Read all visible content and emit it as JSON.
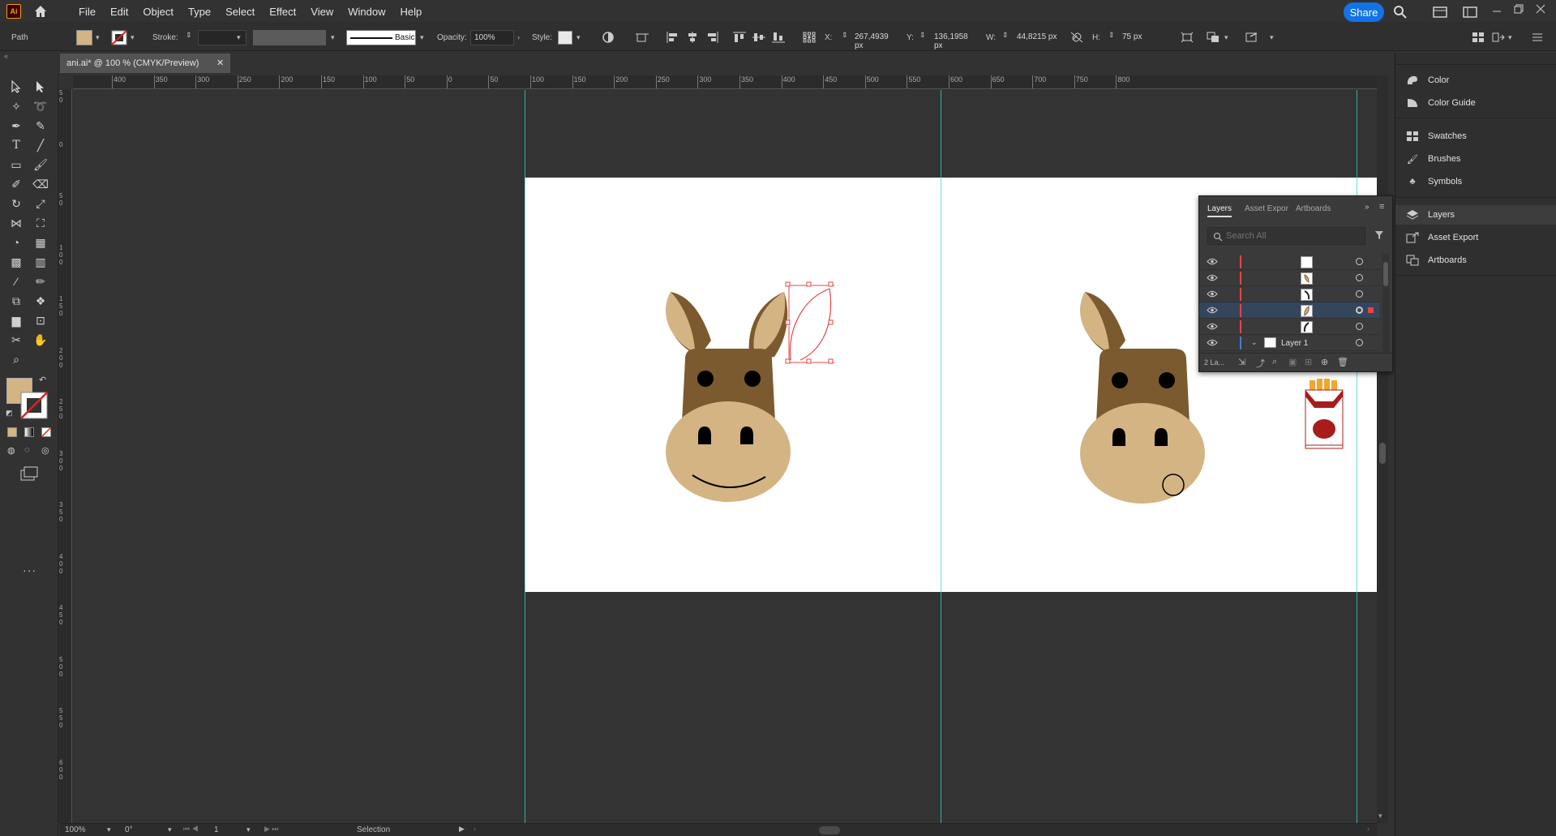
{
  "app": {
    "logo": "Ai",
    "menus": [
      "File",
      "Edit",
      "Object",
      "Type",
      "Select",
      "Effect",
      "View",
      "Window",
      "Help"
    ],
    "share_label": "Share"
  },
  "control_bar": {
    "selection_type": "Path",
    "fill_color": "#d4b483",
    "stroke_label": "Stroke:",
    "brush_label": "Basic",
    "opacity_label": "Opacity:",
    "opacity_value": "100%",
    "style_label": "Style:",
    "x_label": "X:",
    "x_value": "267,4939 px",
    "y_label": "Y:",
    "y_value": "136,1958 px",
    "w_label": "W:",
    "w_value": "44,8215 px",
    "h_label": "H:",
    "h_value": "75 px"
  },
  "document": {
    "tab_title": "ani.ai* @ 100 % (CMYK/Preview)"
  },
  "rulers": {
    "horizontal": [
      "400",
      "350",
      "300",
      "250",
      "200",
      "150",
      "100",
      "50",
      "0",
      "50",
      "100",
      "150",
      "200",
      "250",
      "300",
      "350",
      "400",
      "450",
      "500",
      "550",
      "600",
      "650",
      "700",
      "750",
      "800"
    ],
    "vertical": [
      "50",
      "0",
      "50",
      "100",
      "150",
      "200",
      "250",
      "300",
      "350",
      "400",
      "450",
      "500",
      "550",
      "600"
    ]
  },
  "colors": {
    "donkey_brown": "#7b5a2f",
    "donkey_tan": "#d4b483",
    "guide": "#37d6d6",
    "selection": "#e64545",
    "accent": "#1473e6",
    "cigarette_red": "#a81c1c",
    "cigarette_orange": "#f2a531"
  },
  "layers_panel": {
    "tabs": [
      "Layers",
      "Asset Expor",
      "Artboards"
    ],
    "search_placeholder": "Search All",
    "layer_name": "Layer 1",
    "footer_count": "2 La..."
  },
  "status_bar": {
    "zoom": "100%",
    "rotation": "0°",
    "artboard_number": "1",
    "tool_name": "Selection"
  },
  "dock": {
    "groups": [
      [
        "Color",
        "Color Guide"
      ],
      [
        "Swatches",
        "Brushes",
        "Symbols"
      ],
      [
        "Layers",
        "Asset Export",
        "Artboards"
      ]
    ]
  }
}
